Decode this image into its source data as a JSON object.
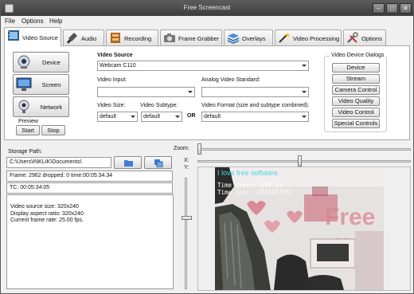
{
  "app": {
    "title": "Free Screencast"
  },
  "window_buttons": {
    "minimize": "–",
    "maximize": "□",
    "close": "✕"
  },
  "menu": [
    "File",
    "Options",
    "Help"
  ],
  "tabs": [
    {
      "label": "Video Source",
      "icon": "film-icon"
    },
    {
      "label": "Audio",
      "icon": "microphone-icon"
    },
    {
      "label": "Recording",
      "icon": "film-reel-icon"
    },
    {
      "label": "Frame Grabber",
      "icon": "camera-icon"
    },
    {
      "label": "Overlays",
      "icon": "layers-icon"
    },
    {
      "label": "Video Processing",
      "icon": "magic-wand-icon"
    },
    {
      "label": "Options",
      "icon": "tools-icon"
    }
  ],
  "source_buttons": {
    "device": "Device",
    "screen": "Screen",
    "network": "Network"
  },
  "preview_group": {
    "title": "Preview",
    "start": "Start",
    "stop": "Stop"
  },
  "video_source": {
    "title": "Video Source",
    "device_value": "Webcam C110",
    "video_input_label": "Video Input:",
    "video_input_value": "",
    "analog_label": "Analog Video Standard:",
    "analog_value": "",
    "size_label": "Video Size:",
    "size_value": "default",
    "subtype_label": "Video Subtype:",
    "subtype_value": "default",
    "or_label": "OR",
    "format_label": "Video Format (size and subtype combined):",
    "format_value": "default"
  },
  "dialogs": {
    "title": "Video Device Dialogs",
    "buttons": [
      "Device",
      "Stream",
      "Camera Control",
      "Video Quality",
      "Video Control",
      "Special Controls"
    ]
  },
  "storage": {
    "label": "Storage Path:",
    "path": "C:\\Users\\INKLIK\\Documents\\"
  },
  "status": {
    "frame": "Frame: 2962 dropped: 0 time:00:05:34.34",
    "tc": "TC: 00:05:34:05"
  },
  "info_lines": [
    "Video source size: 320x240",
    "Display aspect ratio: 320x240",
    "Current frame rate: 25.00 fps."
  ],
  "sliders": {
    "zoom_label": "Zoom:",
    "x_label": "X:",
    "y_label": "Y:",
    "zoom_level": 0.0,
    "x_level": 0.5,
    "y_level": 0.35
  },
  "overlay": {
    "title": "I love free software",
    "line1": "Time (sec): 334.34",
    "line2": "Time (ns): 3343457751",
    "watermark": "Free"
  },
  "colors": {
    "titlebar": "#4a4a4a",
    "overlay_title": "#4ad7e6",
    "wall": "#e9dede",
    "hearts": "#d97c86"
  }
}
